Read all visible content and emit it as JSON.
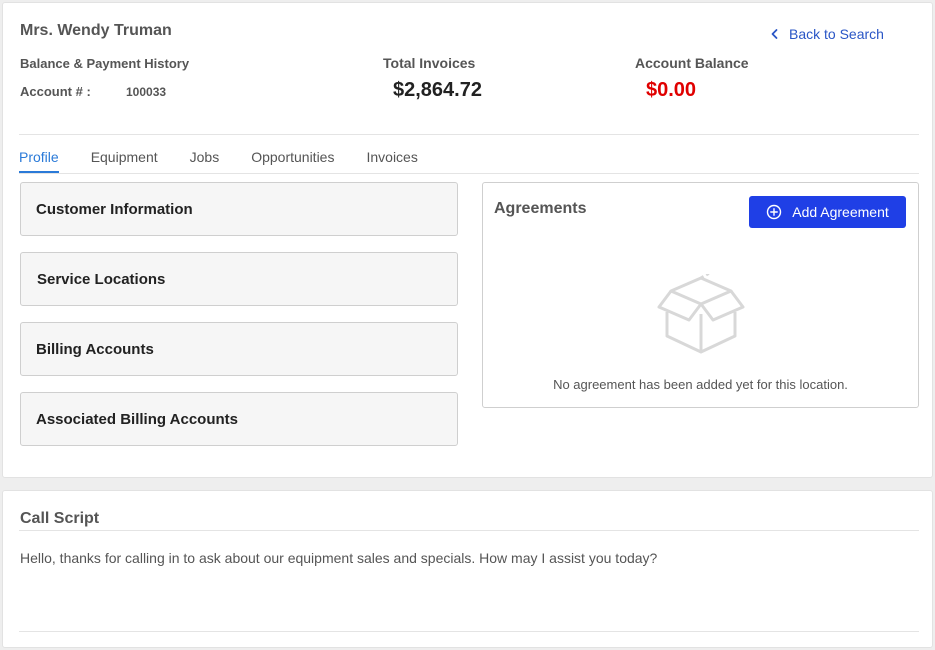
{
  "customer": {
    "name": "Mrs. Wendy Truman",
    "section_label": "Balance & Payment History",
    "account_label": "Account # :",
    "account_number": "100033"
  },
  "summary": {
    "total_invoices_label": "Total Invoices",
    "total_invoices_value": "$2,864.72",
    "account_balance_label": "Account Balance",
    "account_balance_value": "$0.00",
    "balance_color": "#e00000"
  },
  "nav": {
    "back_label": "Back to Search",
    "back_icon": "chevron-left-icon"
  },
  "tabs": [
    {
      "label": "Profile",
      "active": true
    },
    {
      "label": "Equipment",
      "active": false
    },
    {
      "label": "Jobs",
      "active": false
    },
    {
      "label": "Opportunities",
      "active": false
    },
    {
      "label": "Invoices",
      "active": false
    }
  ],
  "sections": [
    {
      "label": "Customer Information"
    },
    {
      "label": "Service Locations"
    },
    {
      "label": "Billing Accounts"
    },
    {
      "label": "Associated Billing Accounts"
    }
  ],
  "agreements": {
    "title": "Agreements",
    "add_label": "Add Agreement",
    "add_icon": "plus-circle-icon",
    "empty_icon": "empty-box-icon",
    "empty_message": "No agreement has been added yet for this location.",
    "button_color": "#1f3fe6"
  },
  "call_script": {
    "title": "Call Script",
    "text": "Hello, thanks for calling in to ask about our equipment sales and specials. How may I assist you today?"
  }
}
